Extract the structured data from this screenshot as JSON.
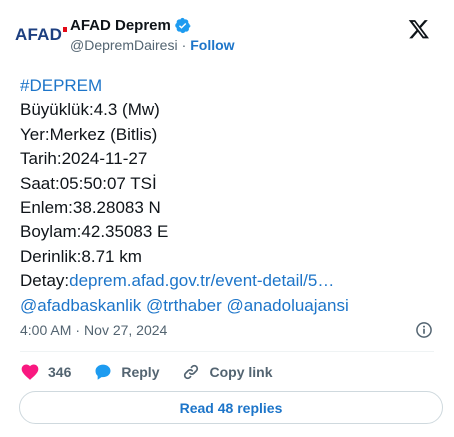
{
  "account": {
    "avatar_text": "AFAD",
    "name": "AFAD Deprem",
    "handle": "@DepremDairesi",
    "separator": "·",
    "follow_label": "Follow",
    "verified_color": "#1d9bf0"
  },
  "tweet": {
    "hashtag": "#DEPREM",
    "lines": {
      "magnitude": "Büyüklük:4.3 (Mw)",
      "location": "Yer:Merkez (Bitlis)",
      "date": "Tarih:2024-11-27",
      "time": "Saat:05:50:07 TSİ",
      "latitude": "Enlem:38.28083 N",
      "longitude": "Boylam:42.35083 E",
      "depth": "Derinlik:8.71 km"
    },
    "detail_label": "Detay:",
    "detail_link": "deprem.afad.gov.tr/event-detail/5…",
    "mentions": [
      "@afadbaskanlik",
      "@trthaber",
      "@anadoluajansi"
    ]
  },
  "meta": {
    "time": "4:00 AM",
    "separator": "·",
    "date": "Nov 27, 2024"
  },
  "actions": {
    "like_count": "346",
    "reply_label": "Reply",
    "copy_link_label": "Copy link"
  },
  "read_replies_label": "Read 48 replies",
  "colors": {
    "link": "#1d75c9",
    "text": "#0f1419",
    "muted": "#536471",
    "heart": "#f91880",
    "reply_bubble": "#1d9bf0",
    "border": "#cfd9de"
  }
}
